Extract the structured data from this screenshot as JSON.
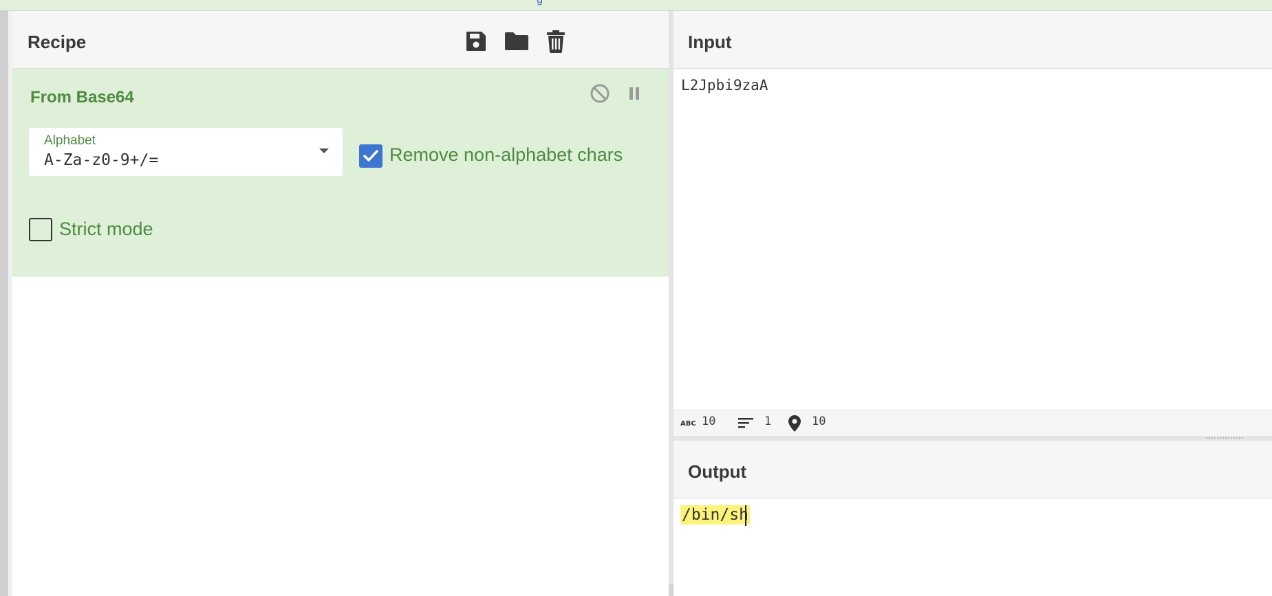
{
  "recipe": {
    "title": "Recipe",
    "icons": [
      "save-icon",
      "folder-icon",
      "trash-icon"
    ],
    "operation": {
      "name": "From Base64",
      "icons": [
        "disable-icon",
        "pause-icon"
      ],
      "alphabet": {
        "label": "Alphabet",
        "value": "A-Za-z0-9+/="
      },
      "remove_non_alphabet": {
        "label": "Remove non-alphabet chars",
        "checked": true
      },
      "strict_mode": {
        "label": "Strict mode",
        "checked": false
      }
    }
  },
  "input": {
    "title": "Input",
    "text": "L2Jpbi9zaA",
    "status": {
      "chars": "10",
      "lines": "1",
      "position": "10"
    }
  },
  "output": {
    "title": "Output",
    "text": "/bin/sh"
  },
  "colors": {
    "accent_green": "#4f8a42",
    "op_bg": "#dff0d8",
    "checkbox_blue": "#3e75d1",
    "highlight": "#fbf37a"
  }
}
